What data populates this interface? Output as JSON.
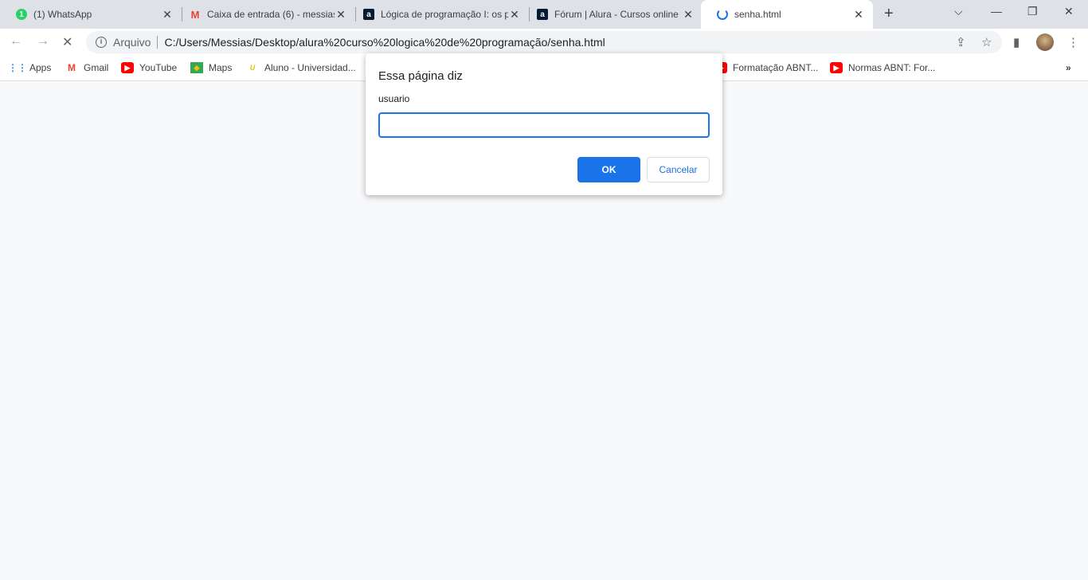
{
  "tabs": [
    {
      "title": "(1) WhatsApp",
      "icon": "whatsapp-icon",
      "badge": "1"
    },
    {
      "title": "Caixa de entrada (6) - messias",
      "icon": "gmail-icon"
    },
    {
      "title": "Lógica de programação I: os primeiros",
      "icon": "alura-icon"
    },
    {
      "title": "Fórum | Alura - Cursos online",
      "icon": "alura-icon"
    },
    {
      "title": "senha.html",
      "icon": "loading-spinner-icon",
      "active": true
    }
  ],
  "toolbar": {
    "scheme": "Arquivo",
    "url": "C:/Users/Messias/Desktop/alura%20curso%20logica%20de%20programação/senha.html"
  },
  "bookmarks": [
    {
      "label": "Apps"
    },
    {
      "label": "Gmail"
    },
    {
      "label": "YouTube"
    },
    {
      "label": "Maps"
    },
    {
      "label": "Aluno - Universidad..."
    },
    {
      "label": "Formatação ABNT..."
    },
    {
      "label": "Normas ABNT: For..."
    }
  ],
  "dialog": {
    "title": "Essa página diz",
    "message": "usuario",
    "input_value": "",
    "ok_label": "OK",
    "cancel_label": "Cancelar"
  },
  "colors": {
    "accent": "#1a73e8"
  }
}
